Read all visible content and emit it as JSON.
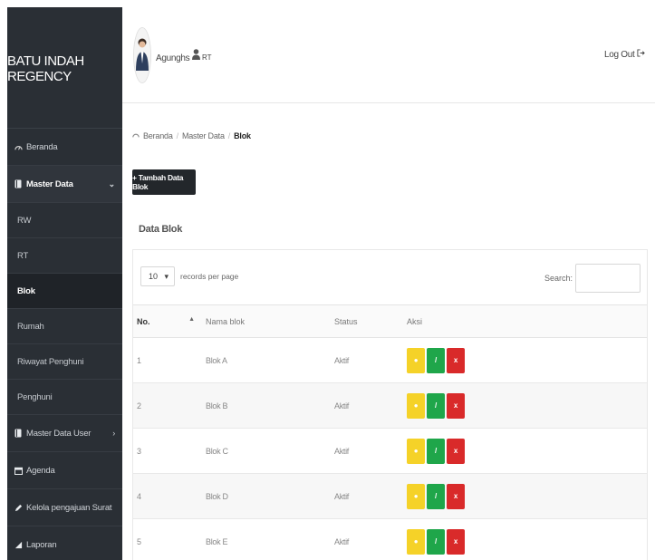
{
  "sidebar": {
    "brand": "BATU INDAH REGENCY",
    "items": [
      {
        "label": "Beranda",
        "icon": "dashboard-icon"
      },
      {
        "label": "Master Data",
        "icon": "book-icon"
      },
      {
        "label": "Master Data User",
        "icon": "book-icon"
      },
      {
        "label": "Agenda",
        "icon": "calendar-icon"
      },
      {
        "label": "Kelola pengajuan Surat",
        "icon": "pencil-icon"
      },
      {
        "label": "Laporan",
        "icon": "chart-icon"
      }
    ],
    "submenu": [
      "RW",
      "RT",
      "Blok",
      "Rumah",
      "Riwayat Penghuni",
      "Penghuni"
    ],
    "active_sub": "Blok"
  },
  "header": {
    "username": "Agunghs",
    "role": "RT",
    "logout": "Log Out"
  },
  "breadcrumb": [
    "Beranda",
    "Master Data",
    "Blok"
  ],
  "add_button": "+ Tambah Data Blok",
  "section_title": "Data Blok",
  "table_controls": {
    "length_value": "10",
    "length_suffix": "records per page",
    "search_label": "Search:"
  },
  "table": {
    "columns": [
      "No.",
      "Nama blok",
      "Status",
      "Aksi"
    ],
    "rows": [
      {
        "no": "1",
        "nama": "Blok A",
        "status": "Aktif"
      },
      {
        "no": "2",
        "nama": "Blok B",
        "status": "Aktif"
      },
      {
        "no": "3",
        "nama": "Blok C",
        "status": "Aktif"
      },
      {
        "no": "4",
        "nama": "Blok D",
        "status": "Aktif"
      },
      {
        "no": "5",
        "nama": "Blok E",
        "status": "Aktif"
      }
    ],
    "action_labels": {
      "view": "●",
      "edit": "/",
      "delete": "x"
    }
  },
  "colors": {
    "sidebar_bg": "#2a2f35",
    "view_btn": "#f5d228",
    "edit_btn": "#1fa64a",
    "delete_btn": "#d92a2a"
  }
}
